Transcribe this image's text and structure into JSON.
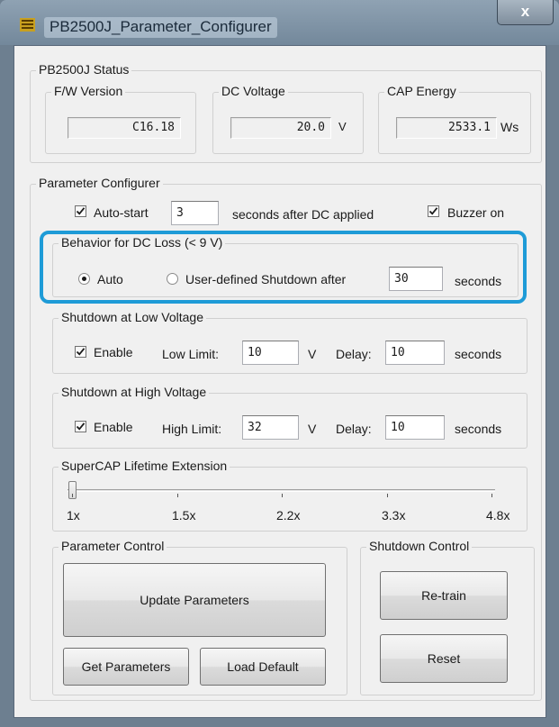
{
  "window": {
    "title": "PB2500J_Parameter_Configurer",
    "close_glyph": "x"
  },
  "status": {
    "legend": "PB2500J Status",
    "fw": {
      "legend": "F/W Version",
      "value": "C16.18"
    },
    "dc": {
      "legend": "DC Voltage",
      "value": "20.0",
      "unit": "V"
    },
    "cap": {
      "legend": "CAP Energy",
      "value": "2533.1",
      "unit": "Ws"
    }
  },
  "config": {
    "legend": "Parameter Configurer",
    "autostart": {
      "label": "Auto-start",
      "checked": true,
      "value": "3",
      "suffix": "seconds after DC applied"
    },
    "buzzer": {
      "label": "Buzzer on",
      "checked": true
    }
  },
  "dc_loss": {
    "legend": "Behavior for DC Loss (< 9 V)",
    "auto_label": "Auto",
    "auto_selected": true,
    "user_label": "User-defined Shutdown after",
    "user_selected": false,
    "value": "30",
    "suffix": "seconds"
  },
  "low_voltage": {
    "legend": "Shutdown at Low Voltage",
    "enable_label": "Enable",
    "enabled": true,
    "limit_label": "Low Limit:",
    "limit_value": "10",
    "unit": "V",
    "delay_label": "Delay:",
    "delay_value": "10",
    "delay_suffix": "seconds"
  },
  "high_voltage": {
    "legend": "Shutdown at High Voltage",
    "enable_label": "Enable",
    "enabled": true,
    "limit_label": "High Limit:",
    "limit_value": "32",
    "unit": "V",
    "delay_label": "Delay:",
    "delay_value": "10",
    "delay_suffix": "seconds"
  },
  "supercap": {
    "legend": "SuperCAP Lifetime Extension",
    "ticks": [
      "1x",
      "1.5x",
      "2.2x",
      "3.3x",
      "4.8x"
    ],
    "selected_index": 0
  },
  "param_control": {
    "legend": "Parameter Control",
    "update_label": "Update Parameters",
    "get_label": "Get Parameters",
    "load_label": "Load Default"
  },
  "shutdown_control": {
    "legend": "Shutdown Control",
    "retrain_label": "Re-train",
    "reset_label": "Reset"
  },
  "colors": {
    "highlight": "#1e9bd7",
    "titlebar": "#7f92a4",
    "client_bg": "#f0f0f0"
  }
}
